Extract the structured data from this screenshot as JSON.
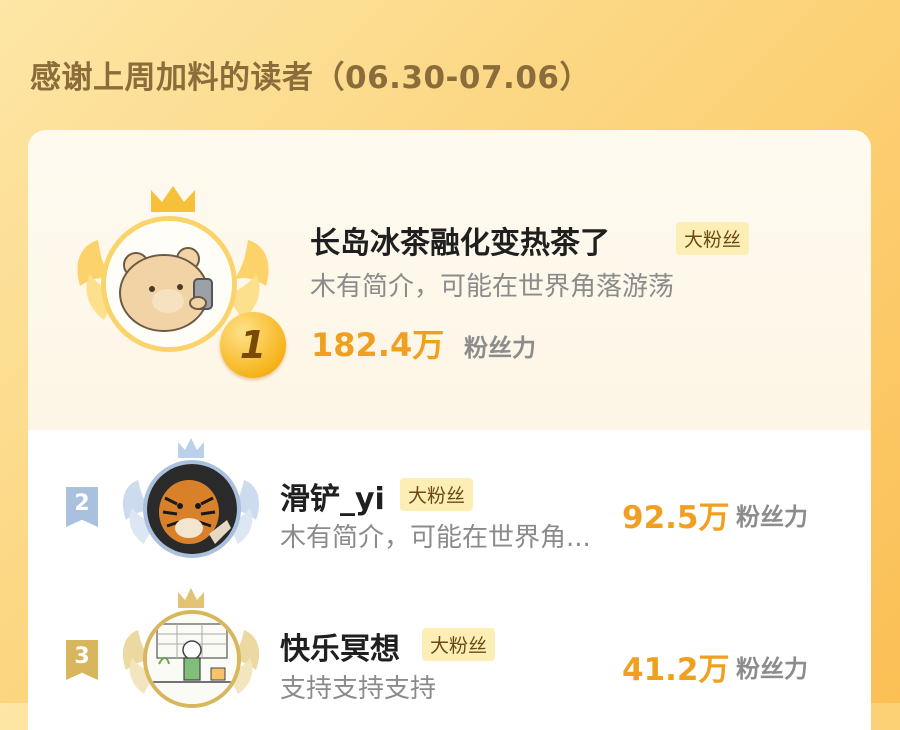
{
  "header": {
    "title": "感谢上周加料的读者（06.30-07.06）"
  },
  "colors": {
    "accent": "#f0a020",
    "gold": "#f6b41b",
    "silver": "#9fb6d6",
    "bronze": "#d9b65c",
    "tag_bg": "#fdeeb5"
  },
  "readers": [
    {
      "rank": "1",
      "name": "长岛冰茶融化变热茶了",
      "tag": "大粉丝",
      "bio": "木有简介，可能在世界角落游荡",
      "score": "182.4万",
      "score_label": "粉丝力",
      "avatar_icon": "cartoon-bear-avatar"
    },
    {
      "rank": "2",
      "name": "滑铲_yi",
      "tag": "大粉丝",
      "bio": "木有简介，可能在世界角...",
      "score": "92.5万",
      "score_label": "粉丝力",
      "avatar_icon": "tiger-avatar"
    },
    {
      "rank": "3",
      "name": "快乐冥想",
      "tag": "大粉丝",
      "bio": "支持支持支持",
      "score": "41.2万",
      "score_label": "粉丝力",
      "avatar_icon": "cartoon-room-avatar"
    }
  ]
}
